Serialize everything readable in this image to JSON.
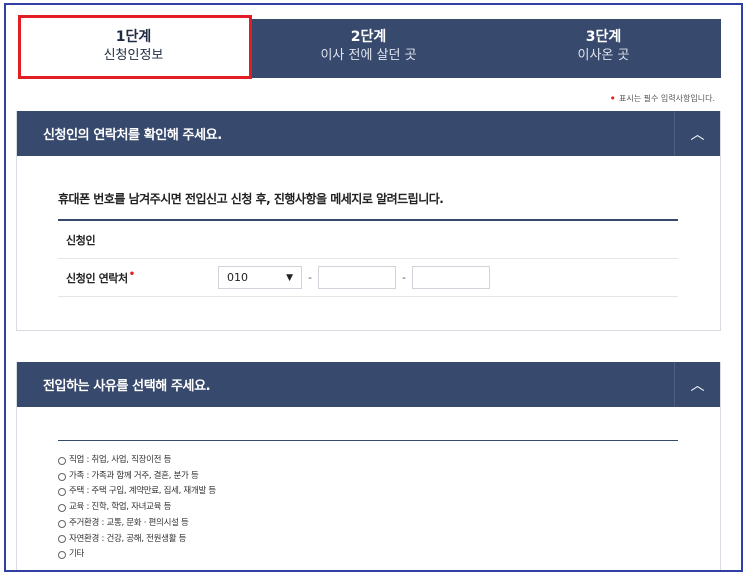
{
  "steps": [
    {
      "num": "1단계",
      "label": "신청인정보",
      "active": true
    },
    {
      "num": "2단계",
      "label": "이사 전에 살던 곳",
      "active": false
    },
    {
      "num": "3단계",
      "label": "이사온 곳",
      "active": false
    }
  ],
  "required_note": "표시는 필수 입력사항입니다.",
  "section1": {
    "title": "신청인의 연락처를 확인해 주세요.",
    "notice": "휴대폰 번호를 남겨주시면 전입신고 신청 후, 진행사항을 메세지로 알려드립니다.",
    "applicant_label": "신청인",
    "applicant_value": "",
    "phone_label": "신청인 연락처",
    "phone_prefix": "010",
    "phone_mid": "",
    "phone_last": "",
    "dash": "-"
  },
  "section2": {
    "title": "전입하는 사유를 선택해 주세요.",
    "reasons": [
      "직업 : 취업, 사업, 직장이전 등",
      "가족 : 가족과 함께 거주, 결혼, 분가 등",
      "주택 : 주택 구입, 계약만료, 집세, 재개발 등",
      "교육 : 진학, 학업, 자녀교육 등",
      "주거환경 : 교통, 문화 · 편의시설 등",
      "자연환경 : 건강, 공해, 전원생활 등",
      "기타"
    ]
  },
  "colors": {
    "navy": "#37496d",
    "highlight": "#e21d23",
    "frame": "#2f3fa3"
  }
}
